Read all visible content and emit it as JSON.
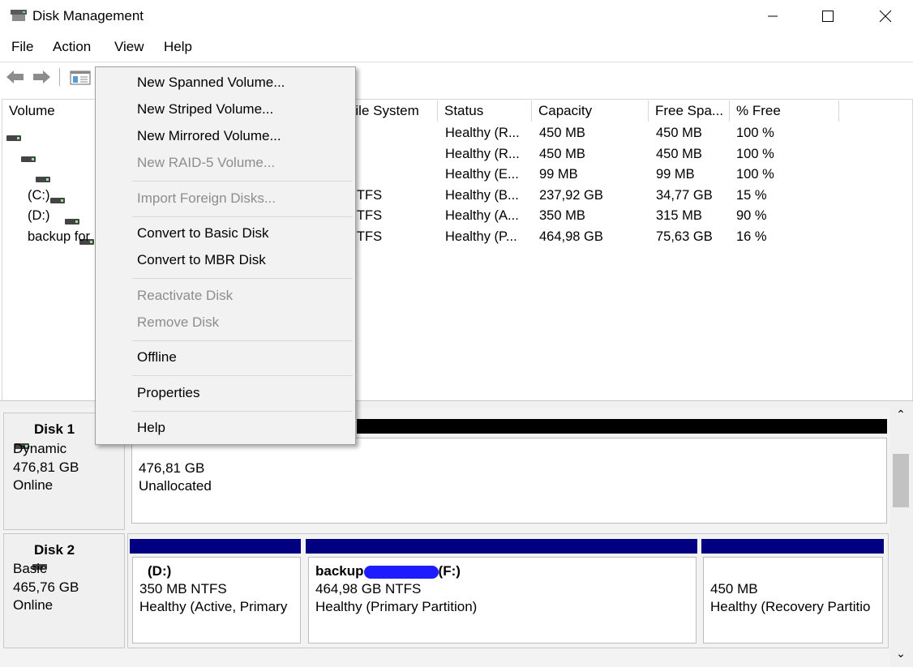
{
  "window": {
    "title": "Disk Management",
    "minimize_glyph": "—",
    "maximize_glyph": "☐",
    "close_glyph": "✕"
  },
  "menubar": [
    "File",
    "Action",
    "View",
    "Help"
  ],
  "toolbar": {
    "icons": [
      "back-arrow-icon",
      "forward-arrow-icon",
      "console-tree-icon"
    ]
  },
  "volume_list": {
    "columns": [
      "Volume",
      "File System",
      "Status",
      "Capacity",
      "Free Spa...",
      "% Free"
    ],
    "rows": [
      {
        "volume": "",
        "fs": "",
        "status": "Healthy (R...",
        "capacity": "450 MB",
        "free": "450 MB",
        "pct": "100 %"
      },
      {
        "volume": "",
        "fs": "",
        "status": "Healthy (R...",
        "capacity": "450 MB",
        "free": "450 MB",
        "pct": "100 %"
      },
      {
        "volume": "",
        "fs": "",
        "status": "Healthy (E...",
        "capacity": "99 MB",
        "free": "99 MB",
        "pct": "100 %"
      },
      {
        "volume": "(C:)",
        "fs": "NTFS",
        "status": "Healthy (B...",
        "capacity": "237,92 GB",
        "free": "34,77 GB",
        "pct": "15 %"
      },
      {
        "volume": "(D:)",
        "fs": "NTFS",
        "status": "Healthy (A...",
        "capacity": "350 MB",
        "free": "315 MB",
        "pct": "90 %"
      },
      {
        "volume": "backup for",
        "fs": "NTFS",
        "status": "Healthy (P...",
        "capacity": "464,98 GB",
        "free": "75,63 GB",
        "pct": "16 %"
      }
    ]
  },
  "disks": [
    {
      "name": "Disk 1",
      "type": "Dynamic",
      "size": "476,81 GB",
      "state": "Online",
      "partitions": [
        {
          "line1": "476,81 GB",
          "line2": "Unallocated",
          "bar_color": "#000000"
        }
      ]
    },
    {
      "name": "Disk 2",
      "type": "Basic",
      "size": "465,76 GB",
      "state": "Online",
      "partitions": [
        {
          "title": "(D:)",
          "line1": "350 MB NTFS",
          "line2": "Healthy (Active, Primary",
          "bar_color": "#000080"
        },
        {
          "title": "backup",
          "title_suffix": "(F:)",
          "line1": "464,98 GB NTFS",
          "line2": "Healthy (Primary Partition)",
          "bar_color": "#000080"
        },
        {
          "title": "",
          "line1": "450 MB",
          "line2": "Healthy (Recovery Partitio",
          "bar_color": "#000080"
        }
      ]
    }
  ],
  "context_menu": {
    "items": [
      {
        "label": "New Spanned Volume...",
        "enabled": true
      },
      {
        "label": "New Striped Volume...",
        "enabled": true
      },
      {
        "label": "New Mirrored Volume...",
        "enabled": true
      },
      {
        "label": "New RAID-5 Volume...",
        "enabled": false
      },
      {
        "label": "Import Foreign Disks...",
        "enabled": false
      },
      {
        "label": "Convert to Basic Disk",
        "enabled": true
      },
      {
        "label": "Convert to MBR Disk",
        "enabled": true
      },
      {
        "label": "Reactivate Disk",
        "enabled": false
      },
      {
        "label": "Remove Disk",
        "enabled": false
      },
      {
        "label": "Offline",
        "enabled": true
      },
      {
        "label": "Properties",
        "enabled": true
      },
      {
        "label": "Help",
        "enabled": true
      }
    ]
  },
  "scrollbar": {
    "up_glyph": "⌃",
    "down_glyph": "⌄"
  }
}
